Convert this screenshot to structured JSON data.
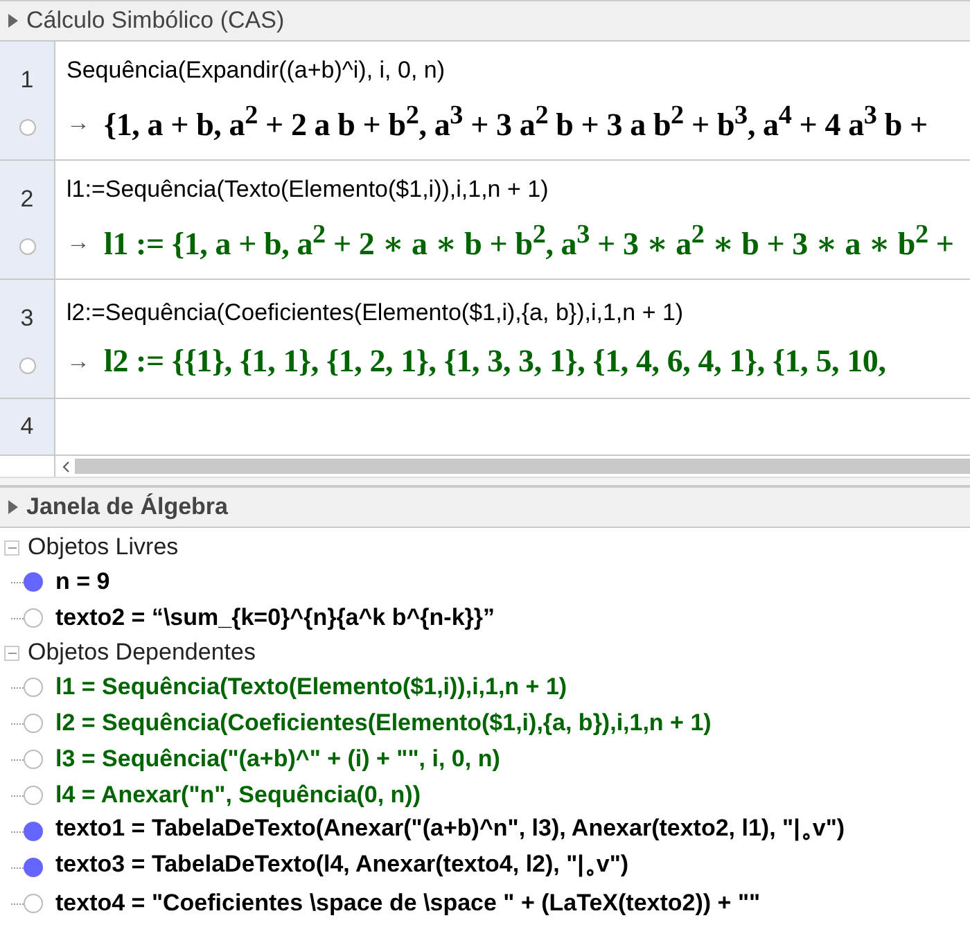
{
  "cas": {
    "title": "Cálculo Simbólico (CAS)",
    "rows": [
      {
        "number": "1",
        "plotted": false,
        "input": "Sequência(Expandir((a+b)^i), i, 0, n)",
        "arrow": "→",
        "output": "{1, a + b, a$^{2}$ + 2 a b + b$^{2}$, a$^{3}$ + 3 a$^{2}$ b + 3 a b$^{2}$ + b$^{3}$, a$^{4}$ + 4 a$^{3}$ b +",
        "color": "#000000"
      },
      {
        "number": "2",
        "plotted": false,
        "input": "l1:=Sequência(Texto(Elemento($1,i)),i,1,n + 1)",
        "arrow": "→",
        "output": "l1 := {1, a + b, a$^{2}$ + 2 ∗ a ∗ b + b$^{2}$, a$^{3}$ + 3 ∗ a$^{2}$ ∗ b + 3 ∗ a ∗ b$^{2}$ +",
        "color": "#006400"
      },
      {
        "number": "3",
        "plotted": false,
        "input": "l2:=Sequência(Coeficientes(Elemento($1,i),{a, b}),i,1,n + 1)",
        "arrow": "→",
        "output": "l2 := {{1}, {1, 1}, {1, 2, 1}, {1, 3, 3, 1}, {1, 4, 6, 4, 1}, {1, 5, 10,",
        "color": "#006400"
      }
    ],
    "empty_row": {
      "number": "4"
    }
  },
  "algebra": {
    "title": "Janela de Álgebra",
    "groups": [
      {
        "title": "Objetos Livres",
        "expanded": true,
        "items": [
          {
            "text": "n = 9",
            "visible": true,
            "color": "#000000"
          },
          {
            "text": "texto2 = “\\sum_{k=0}^{n}{a^k b^{n-k}}”",
            "visible": false,
            "color": "#000000"
          }
        ]
      },
      {
        "title": "Objetos Dependentes",
        "expanded": true,
        "items": [
          {
            "text": "l1 = Sequência(Texto(Elemento($1,i)),i,1,n + 1)",
            "visible": false,
            "color": "#006400"
          },
          {
            "text": "l2 = Sequência(Coeficientes(Elemento($1,i),{a, b}),i,1,n + 1)",
            "visible": false,
            "color": "#006400"
          },
          {
            "text": "l3 = Sequência(\"(a+b)^\" + (i) + \"\", i, 0, n)",
            "visible": false,
            "color": "#006400"
          },
          {
            "text": "l4 = Anexar(\"n\", Sequência(0, n))",
            "visible": false,
            "color": "#006400"
          },
          {
            "text": "texto1 = TabelaDeTexto(Anexar(\"(a+b)^n\", l3), Anexar(texto2, l1), \"|$_{∘}$v\")",
            "visible": true,
            "color": "#000000"
          },
          {
            "text": "texto3 = TabelaDeTexto(l4, Anexar(texto4, l2), \"|$_{∘}$v\")",
            "visible": true,
            "color": "#000000"
          },
          {
            "text": "texto4 = \"Coeficientes \\space de \\space \" + (LaTeX(texto2)) + \"\"",
            "visible": false,
            "color": "#000000"
          }
        ]
      }
    ]
  }
}
